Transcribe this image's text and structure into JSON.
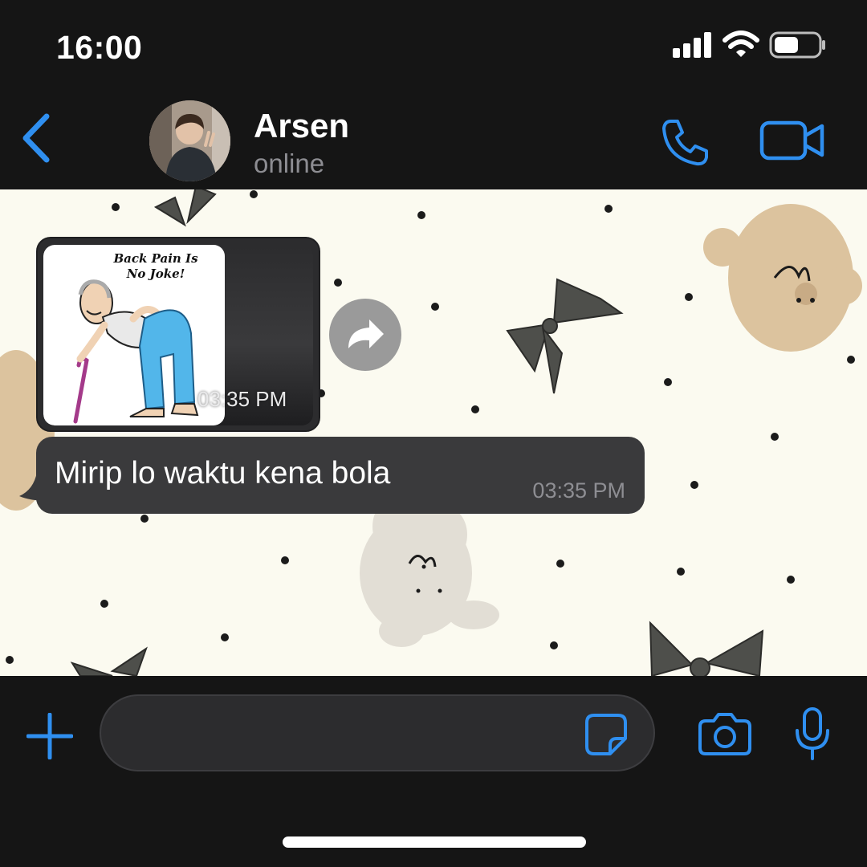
{
  "status_bar": {
    "time": "16:00",
    "icons": [
      "signal-icon",
      "wifi-icon",
      "battery-icon"
    ],
    "battery_level": 0.55
  },
  "header": {
    "back_icon": "chevron-left-icon",
    "contact_name": "Arsen",
    "contact_status": "online",
    "actions": [
      "phone-icon",
      "video-camera-icon"
    ]
  },
  "messages": [
    {
      "type": "image",
      "sticker_text": [
        "Back Pain Is",
        "No Joke!"
      ],
      "time": "03:35 PM",
      "forward_icon": "forward-arrow-icon"
    },
    {
      "type": "text",
      "text": "Mirip lo waktu kena bola",
      "time": "03:35 PM"
    }
  ],
  "input_bar": {
    "plus_icon": "plus-icon",
    "message_value": "",
    "sticker_icon": "sticker-icon",
    "camera_icon": "camera-icon",
    "mic_icon": "microphone-icon"
  },
  "colors": {
    "accent": "#2f8ff0",
    "background": "#151515",
    "bubble": "#3a3a3c",
    "wallpaper": "#fbfaf0"
  }
}
